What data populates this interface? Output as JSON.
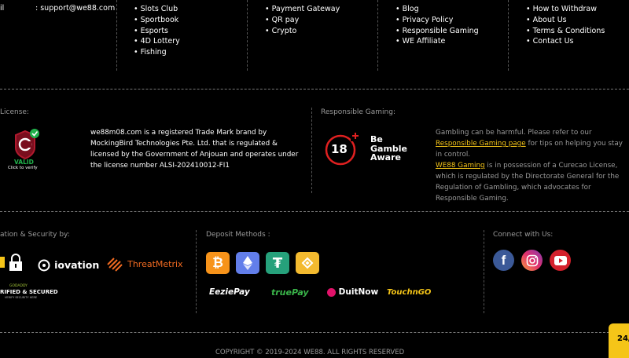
{
  "top": {
    "contact": {
      "label": "il",
      "value": ": support@we88.com"
    },
    "col2": [
      "Slots Club",
      "Sportbook",
      "Esports",
      "4D Lottery",
      "Fishing"
    ],
    "col3": [
      "Payment Gateway",
      "QR pay",
      "Crypto"
    ],
    "col4": [
      "Blog",
      "Privacy Policy",
      "Responsible Gaming",
      "WE Affiliate"
    ],
    "col5": [
      "How to Withdraw",
      "About Us",
      "Terms & Conditions",
      "Contact Us"
    ]
  },
  "license": {
    "heading": "License:",
    "valid": "VALID",
    "verify": "Click to verify",
    "text": "we88m08.com is a registered Trade Mark brand by MockingBird Technologies Pte. Ltd. that is regulated & licensed by the Government of Anjouan and operates under the license number ALSI-202410012-FI1"
  },
  "responsible": {
    "heading": "Responsible Gaming:",
    "age": "18",
    "gamble_line1": "Be",
    "gamble_line2": "Gamble",
    "gamble_line3": "Aware",
    "p1_before": "Gambling can be harmful. Please refer to our ",
    "p1_link": "Responsible Gaming page",
    "p1_after": " for tips on helping you stay in control.",
    "p2_link": "WE88 Gaming",
    "p2_text": " is in possession of a Curecao License, which is regulated by the Directorate General for the Regulation of Gambling, which advocates for Responsible Gaming."
  },
  "security": {
    "heading": "ation & Security by:",
    "brands": [
      "iovation",
      "ThreatMetrix"
    ],
    "badge_top": "GODADDY",
    "badge_main": "RIFIED & SECURED",
    "badge_sub": "VERIFY SECURITY HERE"
  },
  "deposit": {
    "heading": "Deposit Methods :",
    "coins": [
      "bitcoin-icon",
      "ethereum-icon",
      "tether-icon",
      "binance-icon"
    ],
    "wallets": [
      "EeziePay",
      "truePay",
      "DuitNow",
      "TouchnGO"
    ]
  },
  "connect": {
    "heading": "Connect with Us:",
    "facebook": "f"
  },
  "footer": {
    "copyright": "COPYRIGHT © 2019-2024 WE88. ALL RIGHTS RESERVED",
    "chat_badge": "24/"
  },
  "colors": {
    "accent": "#f5c518",
    "background": "#000000",
    "bitcoin": "#f7931a",
    "ethereum": "#627eea",
    "tether": "#26a17b",
    "binance": "#f3ba2f"
  }
}
